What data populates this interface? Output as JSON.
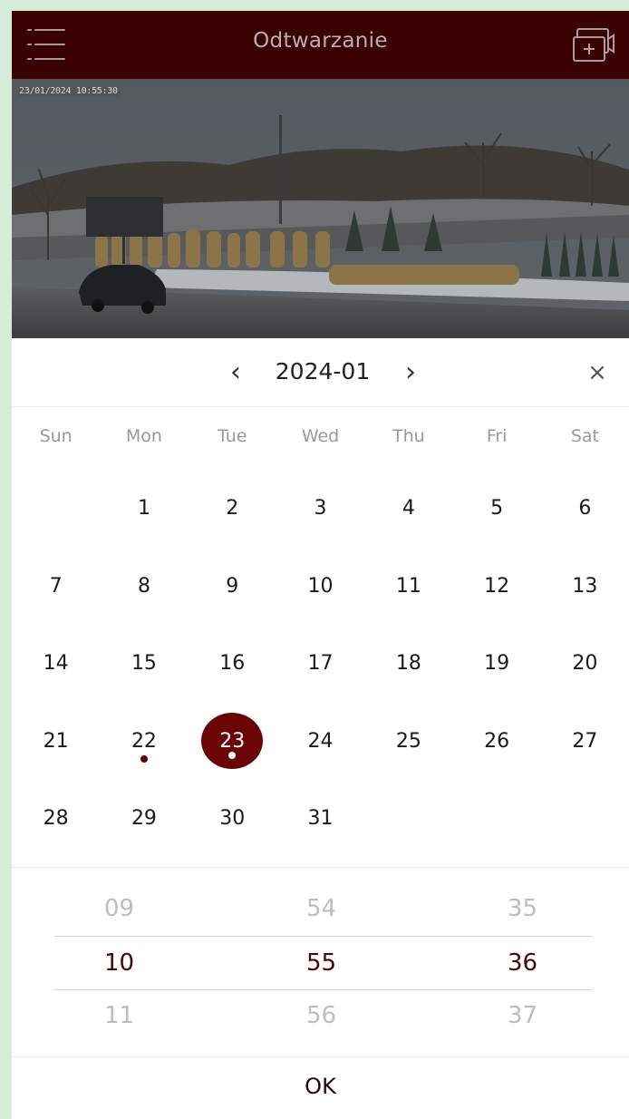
{
  "header": {
    "title": "Odtwarzanie",
    "menu_icon": "hamburger-menu-icon",
    "cast_icon": "screen-cast-icon"
  },
  "camera": {
    "timestamp": "23/01/2024 10:55:30"
  },
  "calendar": {
    "month_label": "2024-01",
    "prev_icon": "chevron-left-icon",
    "next_icon": "chevron-right-icon",
    "close_icon": "close-icon",
    "weekdays": [
      "Sun",
      "Mon",
      "Tue",
      "Wed",
      "Thu",
      "Fri",
      "Sat"
    ],
    "leading_blanks": 1,
    "days_in_month": 31,
    "selected_day": 23,
    "days_with_recordings": [
      22,
      23
    ]
  },
  "time": {
    "hours": [
      "09",
      "10",
      "11"
    ],
    "minutes": [
      "54",
      "55",
      "56"
    ],
    "seconds": [
      "35",
      "36",
      "37"
    ]
  },
  "footer": {
    "ok_label": "OK"
  },
  "colors": {
    "header_bg": "#3a0202",
    "accent": "#6b0505",
    "selected_time": "#4a0606",
    "frame_border": "#d6ecd8"
  }
}
